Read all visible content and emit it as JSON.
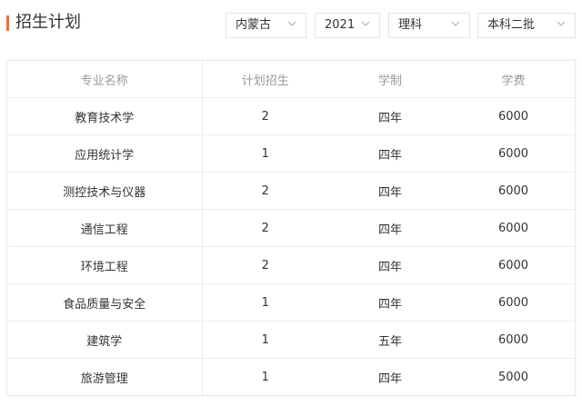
{
  "header": {
    "title": "招生计划",
    "accent_color": "#ff6a2a"
  },
  "filters": [
    {
      "value": "内蒙古",
      "icon": "chevron-down-icon"
    },
    {
      "value": "2021",
      "icon": "chevron-down-icon"
    },
    {
      "value": "理科",
      "icon": "chevron-down-icon"
    },
    {
      "value": "本科二批",
      "icon": "chevron-down-icon"
    }
  ],
  "table": {
    "columns": [
      "专业名称",
      "计划招生",
      "学制",
      "学费"
    ],
    "rows": [
      [
        "教育技术学",
        "2",
        "四年",
        "6000"
      ],
      [
        "应用统计学",
        "1",
        "四年",
        "6000"
      ],
      [
        "测控技术与仪器",
        "2",
        "四年",
        "6000"
      ],
      [
        "通信工程",
        "2",
        "四年",
        "6000"
      ],
      [
        "环境工程",
        "2",
        "四年",
        "6000"
      ],
      [
        "食品质量与安全",
        "1",
        "四年",
        "6000"
      ],
      [
        "建筑学",
        "1",
        "五年",
        "6000"
      ],
      [
        "旅游管理",
        "1",
        "四年",
        "5000"
      ]
    ]
  }
}
